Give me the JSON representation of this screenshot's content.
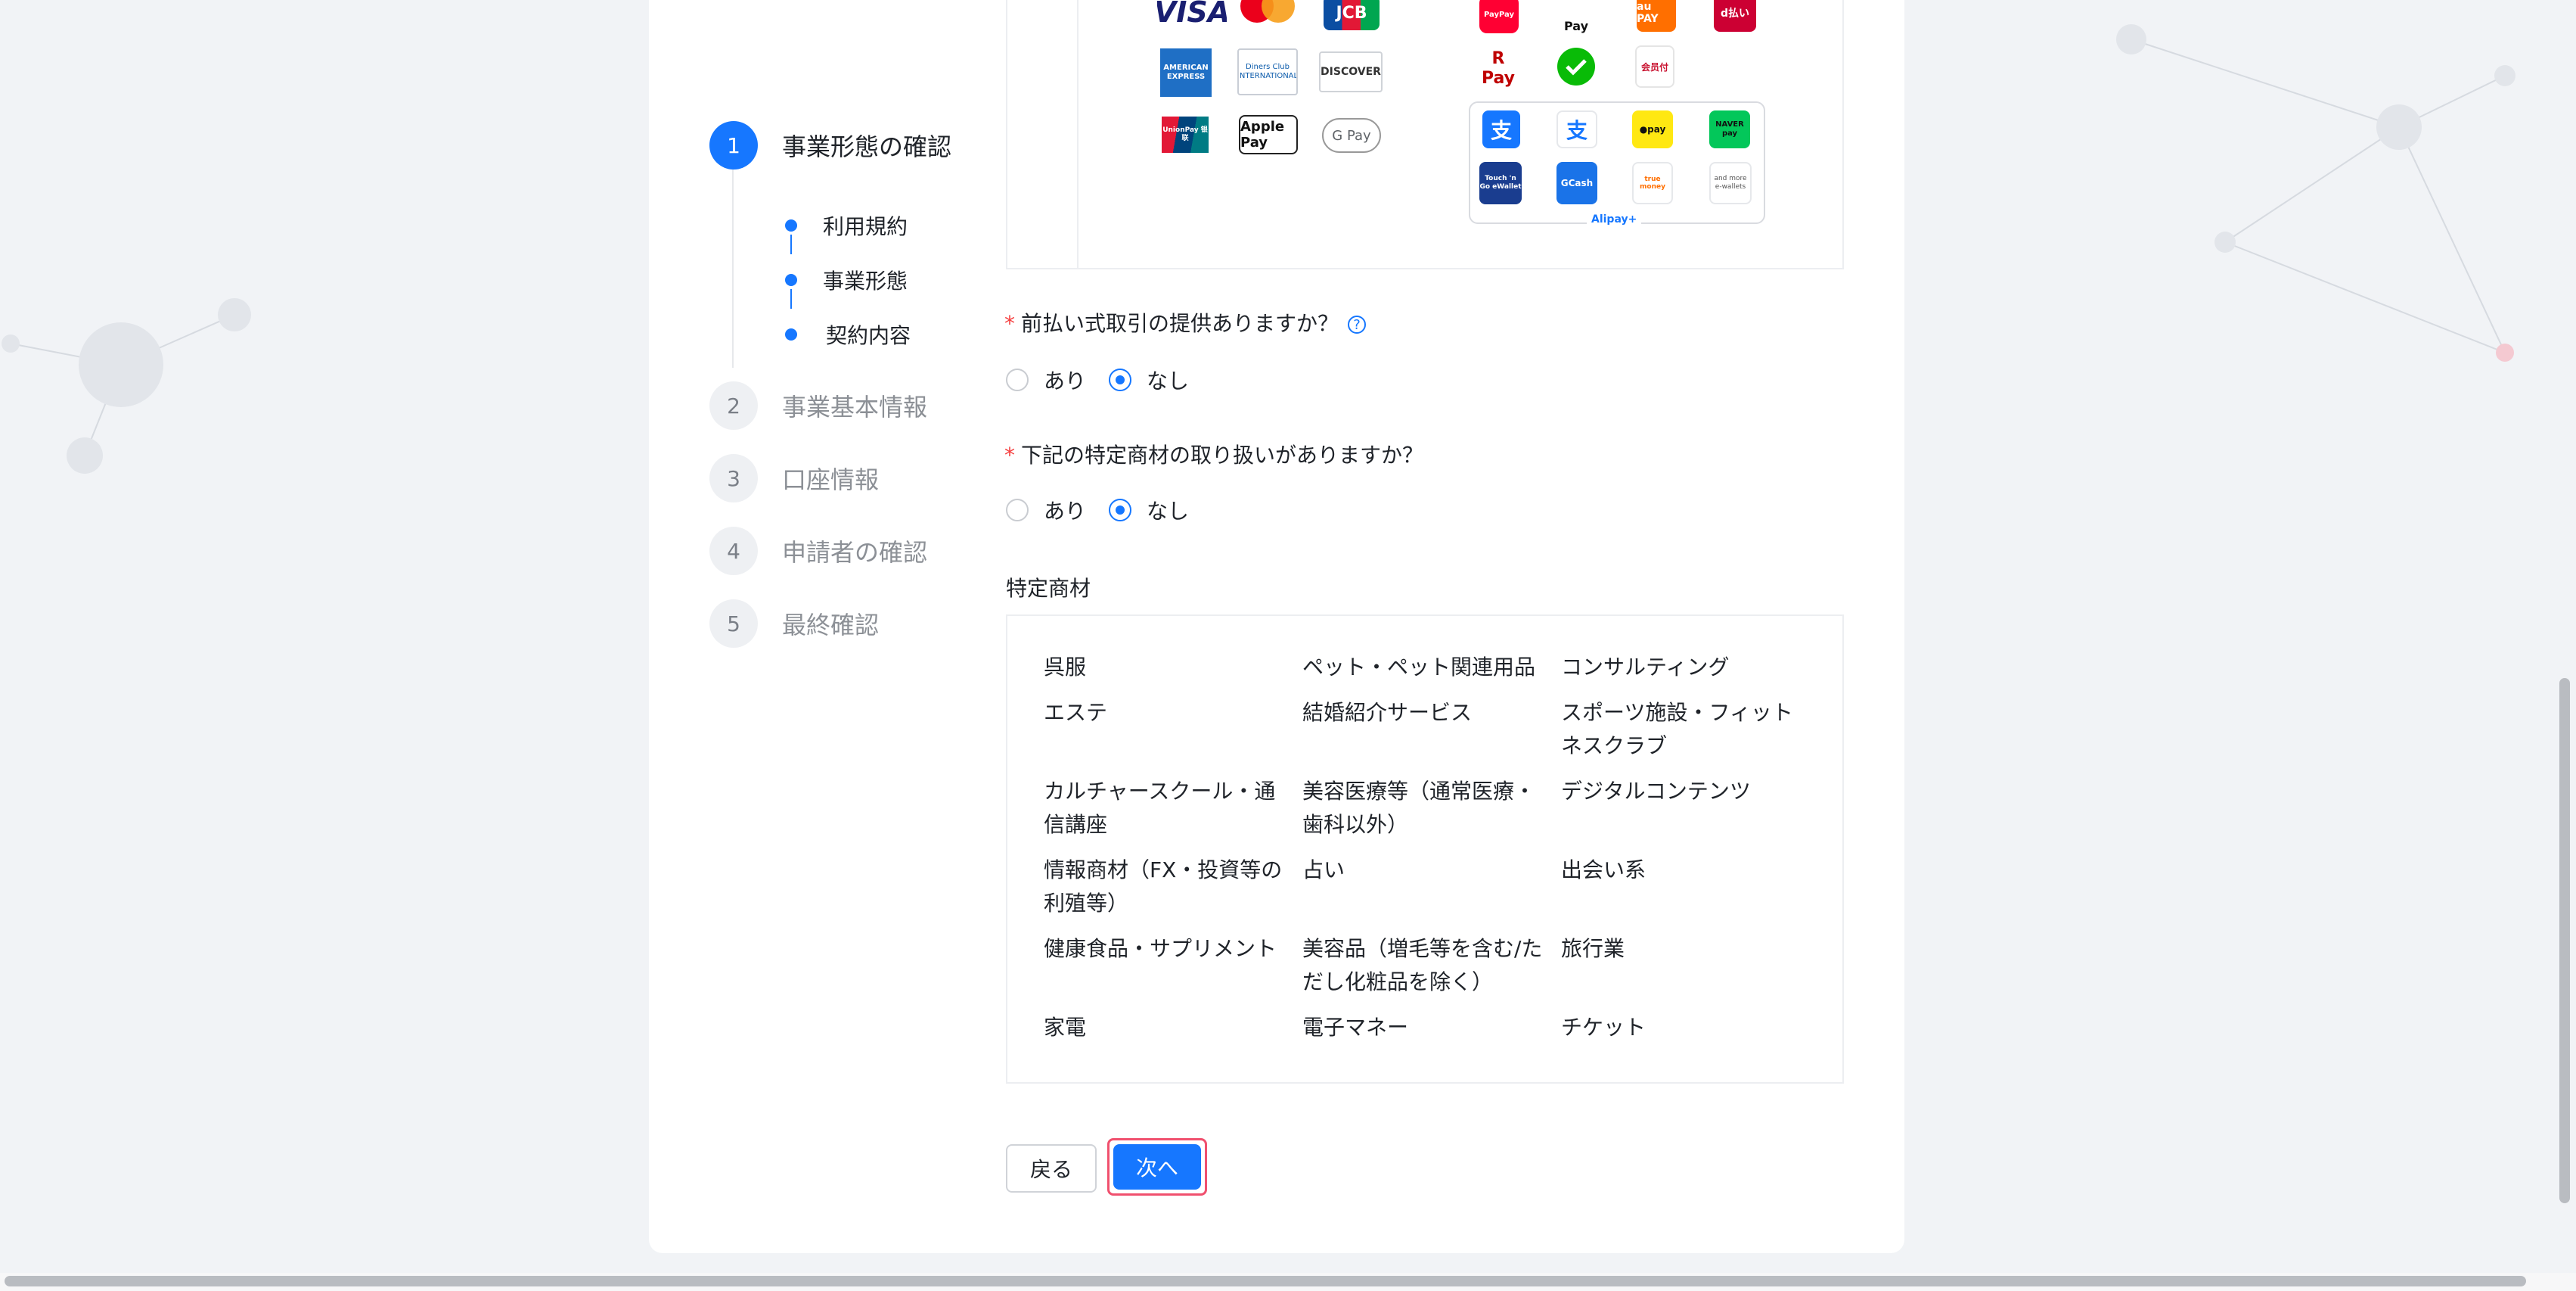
{
  "steps": [
    {
      "num": "1",
      "label": "事業形態の確認",
      "active": true
    },
    {
      "num": "2",
      "label": "事業基本情報"
    },
    {
      "num": "3",
      "label": "口座情報"
    },
    {
      "num": "4",
      "label": "申請者の確認"
    },
    {
      "num": "5",
      "label": "最終確認"
    }
  ],
  "substeps": [
    "利用規約",
    "事業形態",
    "契約内容"
  ],
  "payment_logos": {
    "cards": [
      "VISA",
      "Mastercard",
      "JCB",
      "AMERICAN EXPRESS",
      "Diners Club INTERNATIONAL",
      "DISCOVER",
      "UnionPay 银联",
      "Apple Pay",
      "G Pay"
    ],
    "qr": [
      "PayPay",
      "Pay",
      "au PAY",
      "d払い",
      "R Pay",
      "WeChat Pay",
      "会员付"
    ],
    "ewallets": [
      "Alipay",
      "AlipayHK",
      "Kakao Pay",
      "NAVER pay",
      "Touch 'n Go eWallet",
      "GCash",
      "true money",
      "and more e-wallets"
    ],
    "alipay_plus": "Alipay+"
  },
  "questions": {
    "q1": {
      "text": "前払い式取引の提供ありますか？",
      "options": [
        "あり",
        "なし"
      ],
      "selected": "なし",
      "help": "?"
    },
    "q2": {
      "text": "下記の特定商材の取り扱いがありますか？",
      "options": [
        "あり",
        "なし"
      ],
      "selected": "なし"
    }
  },
  "required_mark": "*",
  "goods": {
    "title": "特定商材",
    "items": [
      "呉服",
      "ペット・ペット関連用品",
      "コンサルティング",
      "エステ",
      "結婚紹介サービス",
      "スポーツ施設・フィットネスクラブ",
      "カルチャースクール・通信講座",
      "美容医療等（通常医療・歯科以外）",
      "デジタルコンテンツ",
      "情報商材（FX・投資等の利殖等）",
      "占い",
      "出会い系",
      "健康食品・サプリメント",
      "美容品（増毛等を含む/ただし化粧品を除く）",
      "旅行業",
      "家電",
      "電子マネー",
      "チケット"
    ]
  },
  "buttons": {
    "back": "戻る",
    "next": "次へ"
  },
  "colors": {
    "primary": "#1677ff",
    "required": "#f53f3f",
    "highlight": "#f0506e"
  }
}
